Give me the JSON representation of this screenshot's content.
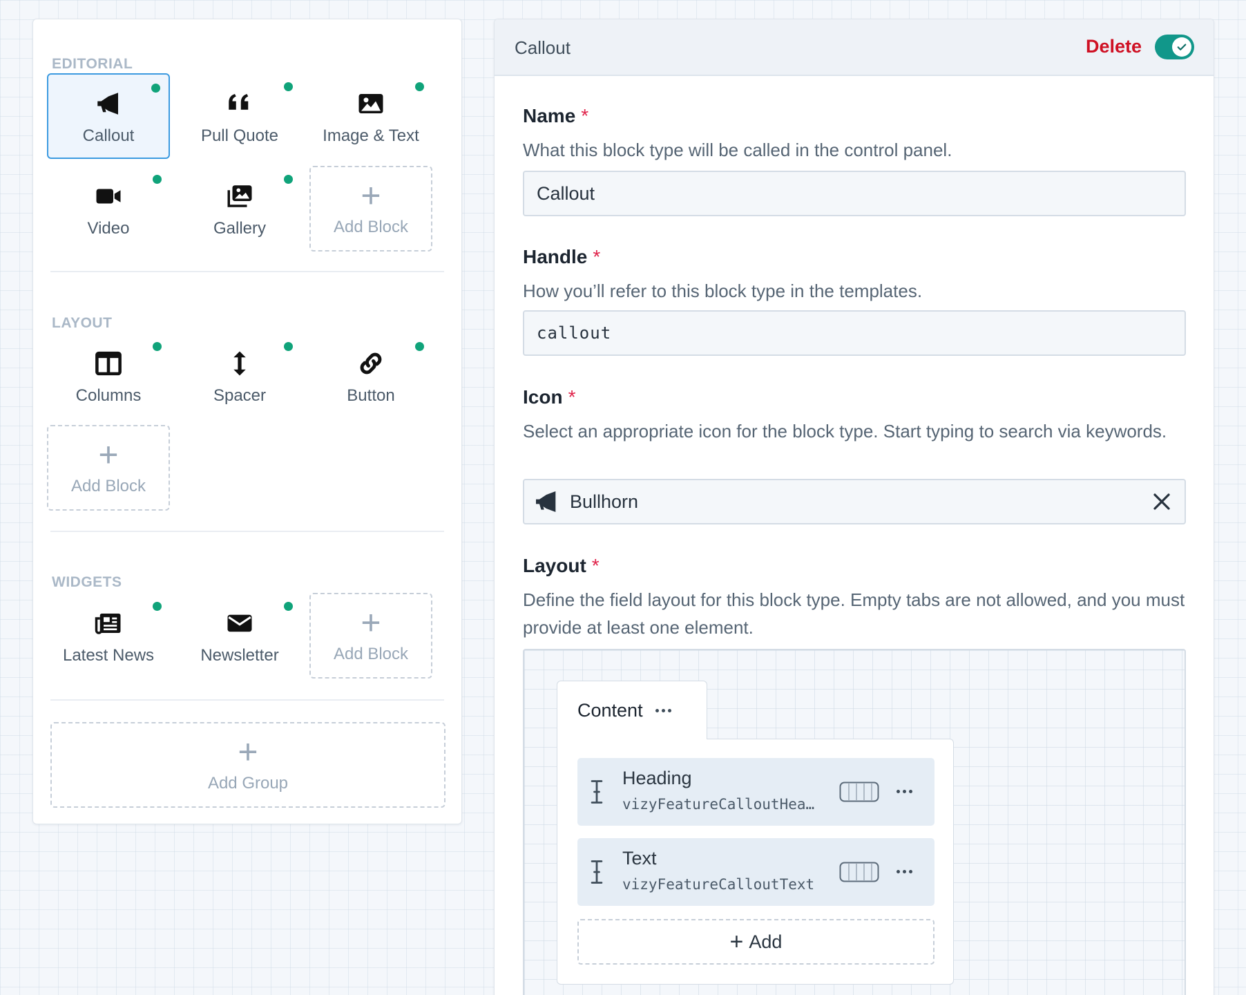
{
  "left_panel": {
    "groups": [
      {
        "title": "EDITORIAL",
        "blocks": [
          {
            "label": "Callout",
            "icon": "bullhorn-icon",
            "selected": true,
            "enabled": true
          },
          {
            "label": "Pull Quote",
            "icon": "quote-icon",
            "selected": false,
            "enabled": true
          },
          {
            "label": "Image & Text",
            "icon": "image-icon",
            "selected": false,
            "enabled": true
          },
          {
            "label": "Video",
            "icon": "video-icon",
            "selected": false,
            "enabled": true
          },
          {
            "label": "Gallery",
            "icon": "images-icon",
            "selected": false,
            "enabled": true
          }
        ],
        "add_block_label": "Add Block"
      },
      {
        "title": "LAYOUT",
        "blocks": [
          {
            "label": "Columns",
            "icon": "columns-icon",
            "selected": false,
            "enabled": true
          },
          {
            "label": "Spacer",
            "icon": "arrows-vertical-icon",
            "selected": false,
            "enabled": true
          },
          {
            "label": "Button",
            "icon": "link-icon",
            "selected": false,
            "enabled": true
          }
        ],
        "add_block_label": "Add Block"
      },
      {
        "title": "WIDGETS",
        "blocks": [
          {
            "label": "Latest News",
            "icon": "newspaper-icon",
            "selected": false,
            "enabled": true
          },
          {
            "label": "Newsletter",
            "icon": "envelope-icon",
            "selected": false,
            "enabled": true
          }
        ],
        "add_block_label": "Add Block"
      }
    ],
    "add_group_label": "Add Group"
  },
  "right_panel": {
    "header": {
      "title": "Callout",
      "delete_label": "Delete",
      "enabled": true
    },
    "name": {
      "label": "Name",
      "required_mark": "*",
      "description": "What this block type will be called in the control panel.",
      "value": "Callout"
    },
    "handle": {
      "label": "Handle",
      "required_mark": "*",
      "description": "How you’ll refer to this block type in the templates.",
      "value": "callout"
    },
    "icon": {
      "label": "Icon",
      "required_mark": "*",
      "description": "Select an appropriate icon for the block type. Start typing to search via keywords.",
      "value": "Bullhorn",
      "value_icon": "bullhorn-icon"
    },
    "layout": {
      "label": "Layout",
      "required_mark": "*",
      "description": "Define the field layout for this block type. Empty tabs are not allowed, and you must provide at least one element.",
      "tab": {
        "label": "Content",
        "fields": [
          {
            "name": "Heading",
            "handle": "vizyFeatureCalloutHeading"
          },
          {
            "name": "Text",
            "handle": "vizyFeatureCalloutText"
          }
        ],
        "add_label": "Add"
      }
    }
  },
  "colors": {
    "accent": "#3b9ae0",
    "enabled_dot": "#10a37a",
    "toggle_on": "#11978a",
    "danger": "#cf1124",
    "required": "#e0234a"
  }
}
